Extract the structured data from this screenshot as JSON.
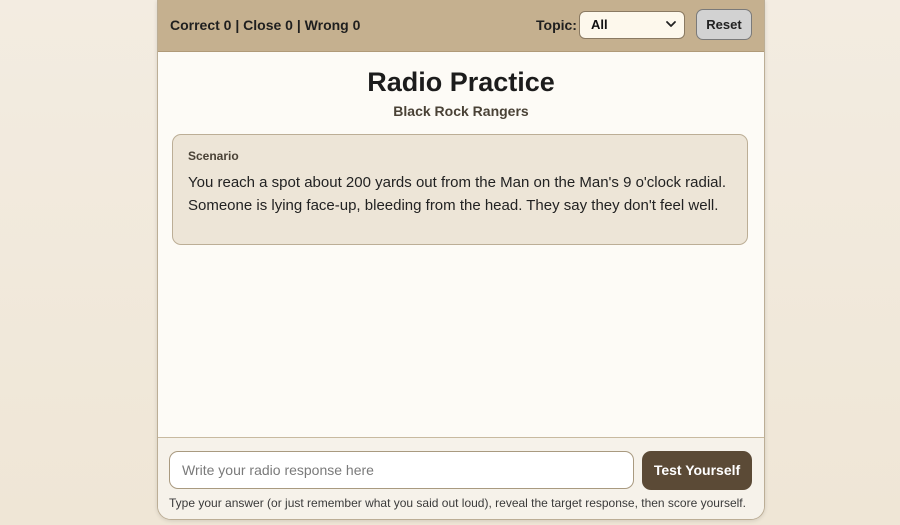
{
  "header": {
    "score_text": "Correct 0 | Close 0 | Wrong 0",
    "topic_label": "Topic:",
    "topic_selected": "All",
    "reset_label": "Reset"
  },
  "main": {
    "title": "Radio Practice",
    "subtitle": "Black Rock Rangers",
    "scenario": {
      "label": "Scenario",
      "text": "You reach a spot about 200 yards out from the Man on the Man's 9 o'clock radial. Someone is lying face-up, bleeding from the head. They say they don't feel well."
    }
  },
  "footer": {
    "input_placeholder": "Write your radio response here",
    "input_value": "",
    "test_label": "Test Yourself",
    "hint": "Type your answer (or just remember what you said out loud), reveal the target response, then score yourself."
  },
  "colors": {
    "header_bg": "#c5b08f",
    "scenario_bg": "#ede5d7",
    "primary_button": "#5b4a36",
    "page_bg": "#fdfbf6"
  }
}
